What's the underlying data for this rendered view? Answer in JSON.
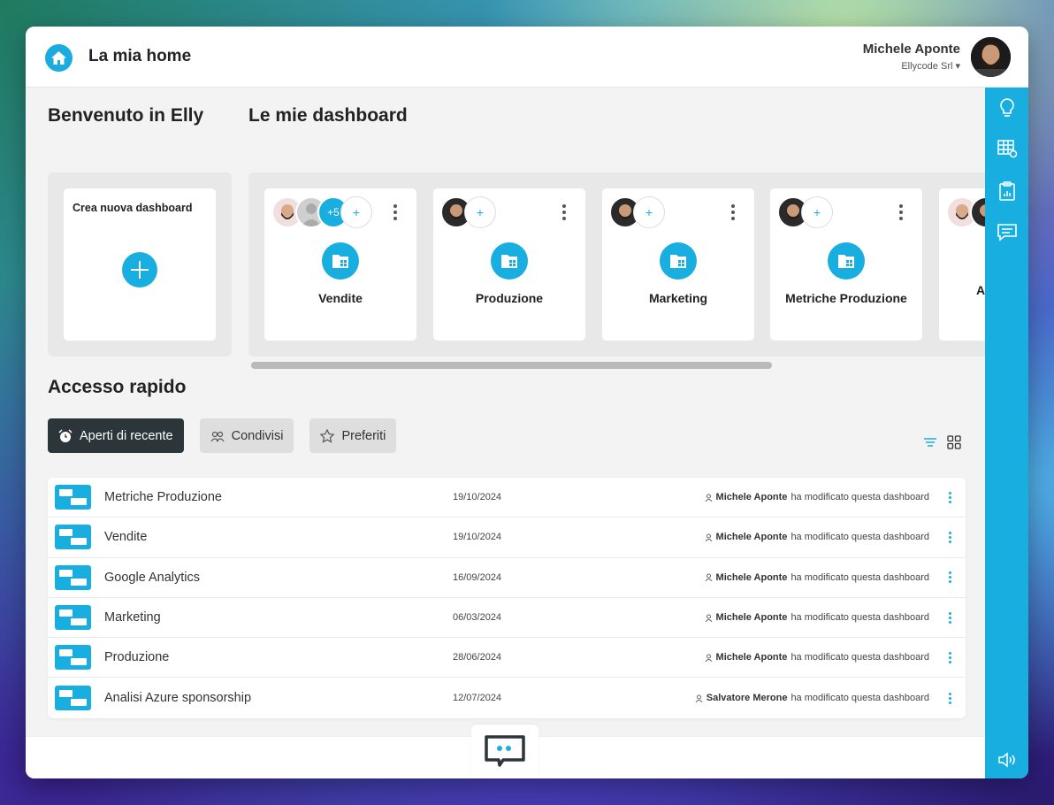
{
  "header": {
    "title": "La mia home",
    "user_name": "Michele Aponte",
    "company": "Ellycode Srl ▾"
  },
  "welcome": {
    "title": "Benvenuto in Elly",
    "create_label": "Crea nuova dashboard"
  },
  "dashboards": {
    "title": "Le mie dashboard",
    "more_count": "+5",
    "add_symbol": "+",
    "cards": [
      {
        "name": "Vendite"
      },
      {
        "name": "Produzione"
      },
      {
        "name": "Marketing"
      },
      {
        "name": "Metriche Produzione"
      },
      {
        "name": "A s"
      }
    ]
  },
  "quick_access": {
    "title": "Accesso rapido",
    "tabs": [
      {
        "label": "Aperti di recente",
        "icon": "alarm-clock-icon",
        "active": true
      },
      {
        "label": "Condivisi",
        "icon": "users-icon",
        "active": false
      },
      {
        "label": "Preferiti",
        "icon": "star-icon",
        "active": false
      }
    ],
    "action_text": "ha modificato questa dashboard",
    "rows": [
      {
        "name": "Metriche Produzione",
        "date": "19/10/2024",
        "user": "Michele Aponte"
      },
      {
        "name": "Vendite",
        "date": "19/10/2024",
        "user": "Michele Aponte"
      },
      {
        "name": "Google Analytics",
        "date": "16/09/2024",
        "user": "Michele Aponte"
      },
      {
        "name": "Marketing",
        "date": "06/03/2024",
        "user": "Michele Aponte"
      },
      {
        "name": "Produzione",
        "date": "28/06/2024",
        "user": "Michele Aponte"
      },
      {
        "name": "Analisi Azure sponsorship",
        "date": "12/07/2024",
        "user": "Salvatore Merone"
      }
    ]
  },
  "colors": {
    "accent": "#19aee0",
    "dark": "#2b353a",
    "background": "#f3f3f3"
  },
  "rail_icons": [
    "lightbulb-icon",
    "table-icon",
    "clipboard-chart-icon",
    "message-icon",
    "speaker-icon"
  ]
}
